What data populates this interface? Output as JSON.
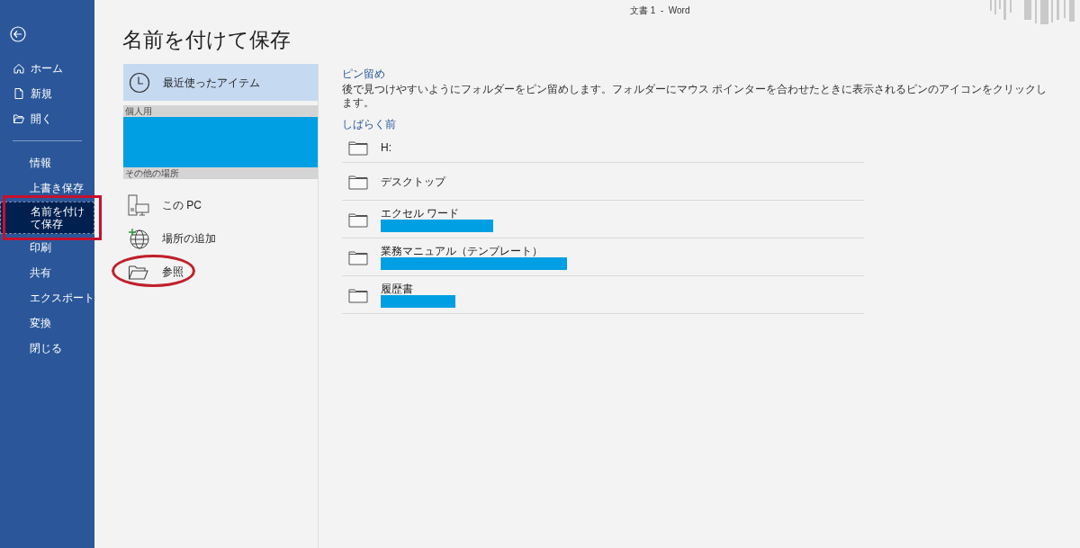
{
  "window": {
    "title": "文書 1  -  Word"
  },
  "sidebar": {
    "items": [
      {
        "kind": "home",
        "label": "ホーム",
        "selected": false,
        "highlighted": false
      },
      {
        "kind": "new",
        "label": "新規",
        "selected": false,
        "highlighted": false
      },
      {
        "kind": "open",
        "label": "開く",
        "selected": false,
        "highlighted": false
      },
      {
        "kind": "divider"
      },
      {
        "kind": "text",
        "label": "情報",
        "selected": false,
        "highlighted": false
      },
      {
        "kind": "text",
        "label": "上書き保存",
        "selected": false,
        "highlighted": false
      },
      {
        "kind": "text",
        "label": "名前を付けて保存",
        "selected": true,
        "highlighted": true
      },
      {
        "kind": "text",
        "label": "印刷",
        "selected": false,
        "highlighted": false
      },
      {
        "kind": "text",
        "label": "共有",
        "selected": false,
        "highlighted": false
      },
      {
        "kind": "text",
        "label": "エクスポート",
        "selected": false,
        "highlighted": false
      },
      {
        "kind": "text",
        "label": "変換",
        "selected": false,
        "highlighted": false
      },
      {
        "kind": "text",
        "label": "閉じる",
        "selected": false,
        "highlighted": false
      }
    ]
  },
  "heading": "名前を付けて保存",
  "locations": [
    {
      "kind": "recent",
      "label": "最近使ったアイテム",
      "selected": true,
      "highlighted": false
    },
    {
      "kind": "section",
      "label": "個人用"
    },
    {
      "kind": "redacted"
    },
    {
      "kind": "section",
      "label": "その他の場所"
    },
    {
      "kind": "pc",
      "label": "この PC",
      "selected": false,
      "highlighted": false
    },
    {
      "kind": "add",
      "label": "場所の追加",
      "selected": false,
      "highlighted": false
    },
    {
      "kind": "browse",
      "label": "参照",
      "selected": false,
      "highlighted": true
    }
  ],
  "pinned": {
    "title": "ピン留め",
    "description": "後で見つけやすいようにフォルダーをピン留めします。フォルダーにマウス ポインターを合わせたときに表示されるピンのアイコンをクリックします。"
  },
  "recent_group": {
    "title": "しばらく前"
  },
  "folders": [
    {
      "name": "H:",
      "redacted": false
    },
    {
      "name": "デスクトップ",
      "redacted": false
    },
    {
      "name": "エクセル ワード",
      "redacted": true
    },
    {
      "name": "業務マニュアル（テンプレート）",
      "redacted": true
    },
    {
      "name": "履歴書",
      "redacted": true
    }
  ]
}
